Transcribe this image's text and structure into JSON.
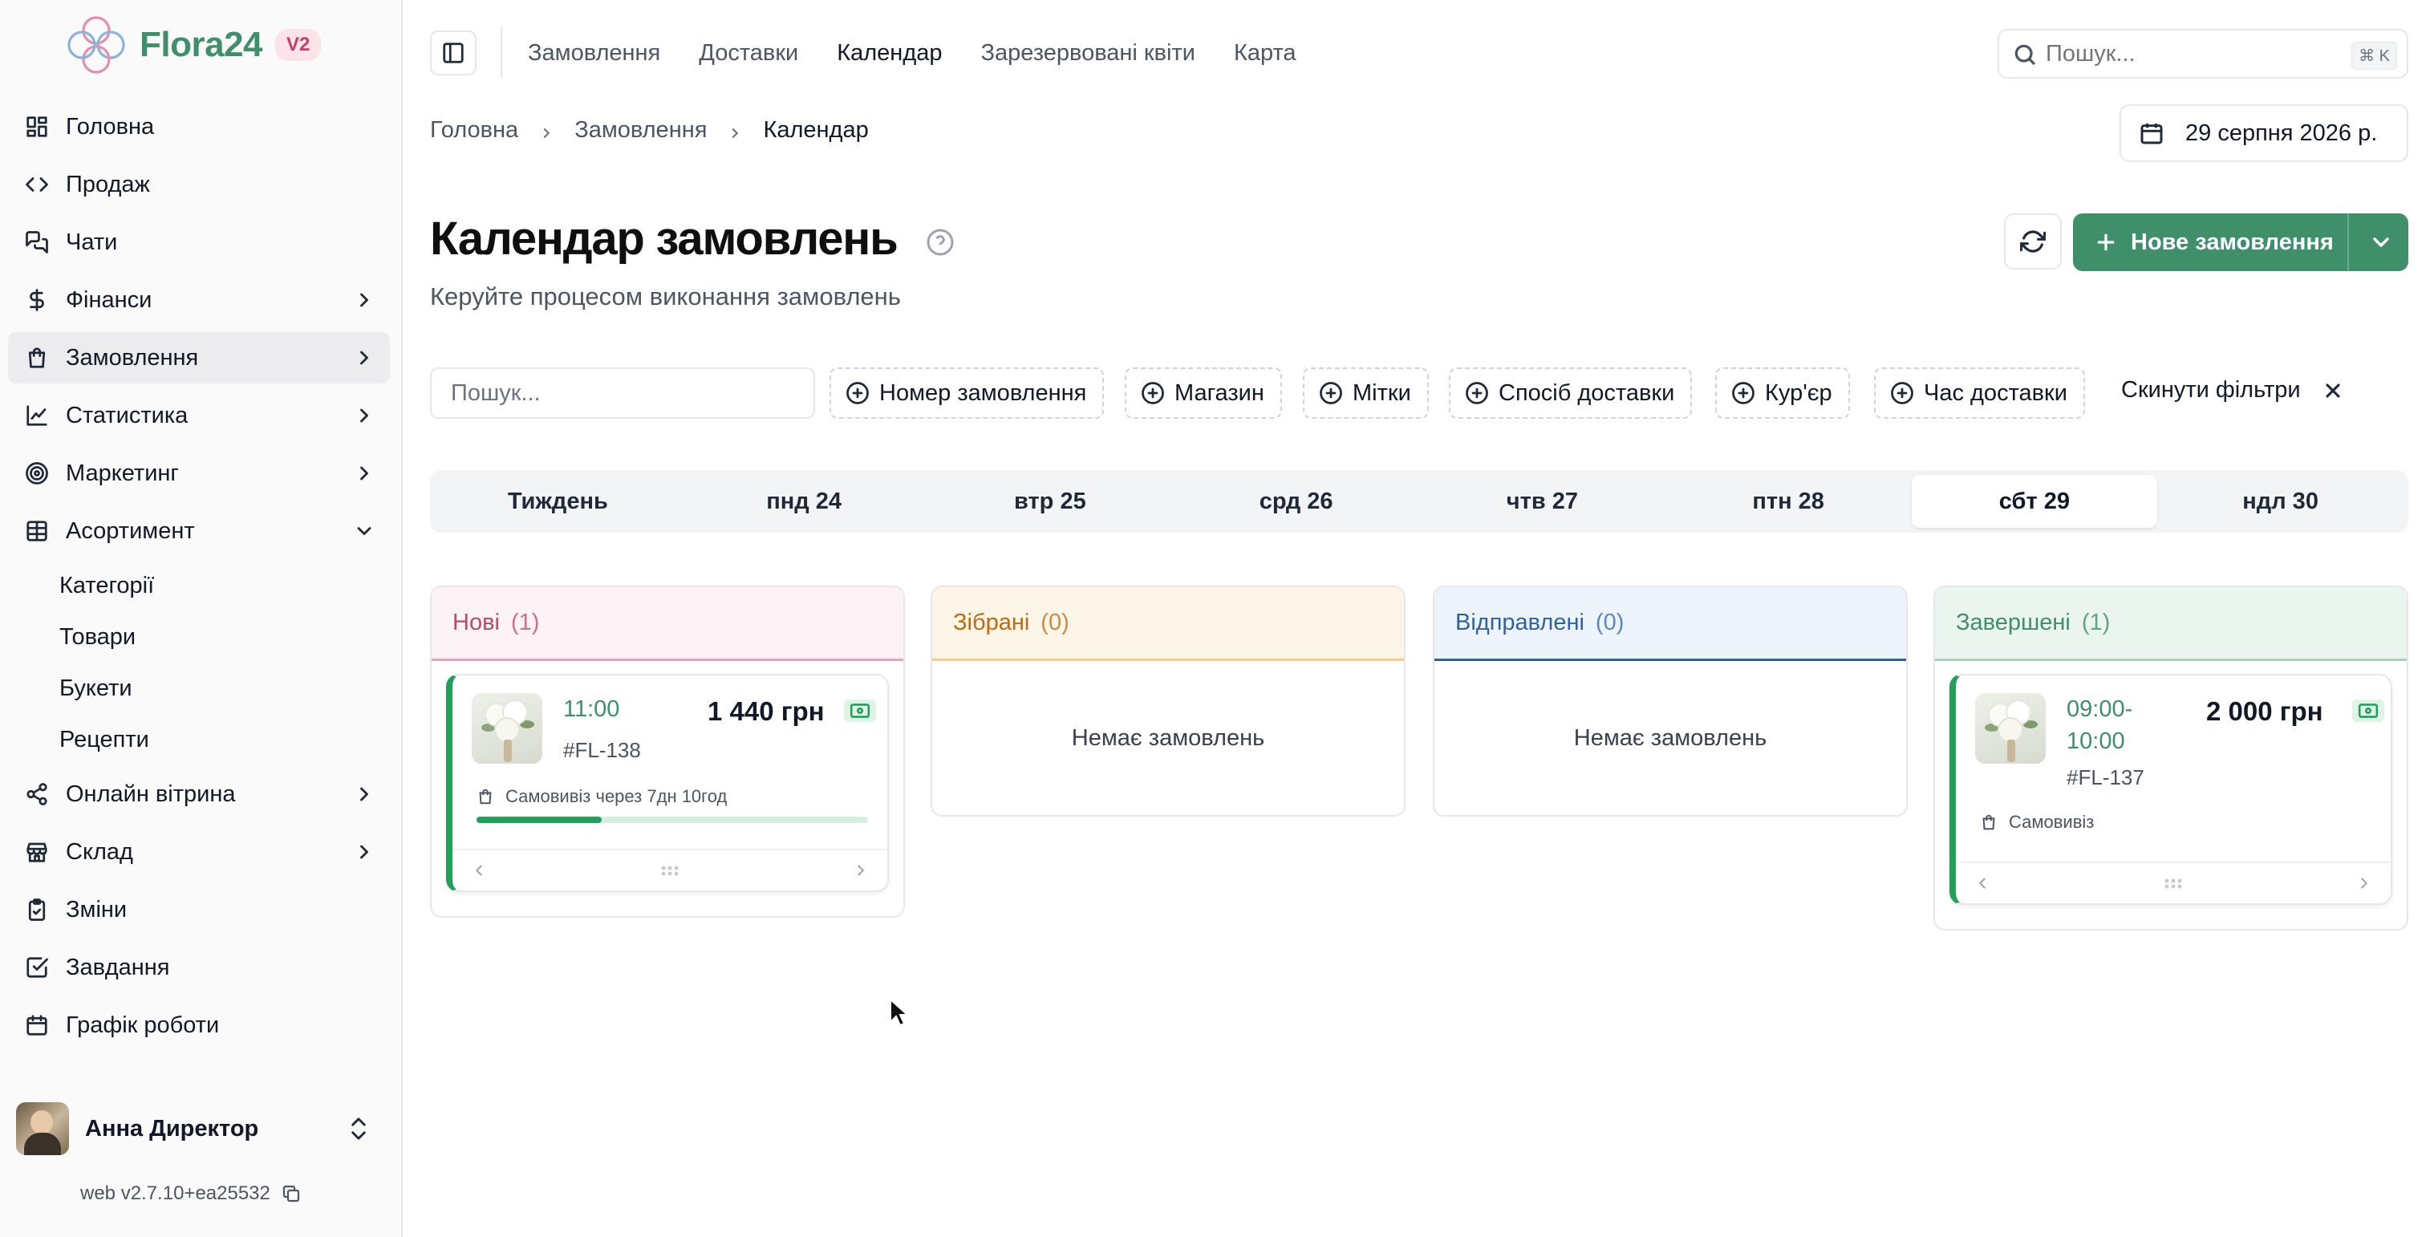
{
  "brand": {
    "name": "Flora24",
    "badge": "V2"
  },
  "sidebar": {
    "items": [
      {
        "label": "Головна",
        "icon": "dashboard-icon"
      },
      {
        "label": "Продаж",
        "icon": "code-icon"
      },
      {
        "label": "Чати",
        "icon": "chat-icon"
      },
      {
        "label": "Фінанси",
        "icon": "dollar-icon",
        "expandable": true
      },
      {
        "label": "Замовлення",
        "icon": "shopping-bag-icon",
        "expandable": true,
        "active": true
      },
      {
        "label": "Статистика",
        "icon": "chart-line-icon",
        "expandable": true
      },
      {
        "label": "Маркетинг",
        "icon": "target-icon",
        "expandable": true
      },
      {
        "label": "Асортимент",
        "icon": "table-icon",
        "expanded": true
      }
    ],
    "sub_items": [
      "Категорії",
      "Товари",
      "Букети",
      "Рецепти"
    ],
    "items_after": [
      {
        "label": "Онлайн вітрина",
        "icon": "share-icon",
        "expandable": true
      },
      {
        "label": "Склад",
        "icon": "store-icon",
        "expandable": true
      },
      {
        "label": "Зміни",
        "icon": "clipboard-icon"
      },
      {
        "label": "Завдання",
        "icon": "checkbox-icon"
      },
      {
        "label": "Графік роботи",
        "icon": "calendar-icon"
      }
    ],
    "user": {
      "name": "Анна Директор"
    },
    "version": "web v2.7.10+ea25532"
  },
  "topnav": {
    "links": [
      "Замовлення",
      "Доставки",
      "Календар",
      "Зарезервовані квіти",
      "Карта"
    ],
    "active_index": 2,
    "search_placeholder": "Пошук...",
    "search_shortcut": "⌘ K"
  },
  "breadcrumb": [
    "Головна",
    "Замовлення",
    "Календар"
  ],
  "date_picker": {
    "value": "29 серпня 2026 р."
  },
  "page": {
    "title": "Календар замовлень",
    "subtitle": "Керуйте процесом виконання замовлень",
    "new_order_label": "Нове замовлення"
  },
  "filters": {
    "search_placeholder": "Пошук...",
    "chips": [
      "Номер замовлення",
      "Магазин",
      "Мітки",
      "Спосіб доставки",
      "Кур'єр",
      "Час доставки"
    ],
    "reset_label": "Скинути фільтри"
  },
  "day_tabs": {
    "tabs": [
      "Тиждень",
      "пнд 24",
      "втр 25",
      "срд 26",
      "чтв 27",
      "птн 28",
      "сбт 29",
      "ндл 30"
    ],
    "active_index": 6
  },
  "columns": [
    {
      "title": "Нові",
      "count": "(1)",
      "color": "#b84a6b"
    },
    {
      "title": "Зібрані",
      "count": "(0)",
      "color": "#c2680c",
      "empty_text": "Немає замовлень"
    },
    {
      "title": "Відправлені",
      "count": "(0)",
      "color": "#2f62a3",
      "empty_text": "Немає замовлень"
    },
    {
      "title": "Завершені",
      "count": "(1)",
      "color": "#3f8f6b"
    }
  ],
  "cards": {
    "new": {
      "time": "11:00",
      "order_number": "#FL-138",
      "price": "1 440 грн",
      "shipping": "Самовивіз через 7дн 10год",
      "progress": 0.32
    },
    "done": {
      "time_line1": "09:00-",
      "time_line2": "10:00",
      "order_number": "#FL-137",
      "price": "2 000 грн",
      "shipping": "Самовивіз"
    }
  },
  "colors": {
    "accent": "#3f8f6b",
    "progress": "#22a05a"
  }
}
